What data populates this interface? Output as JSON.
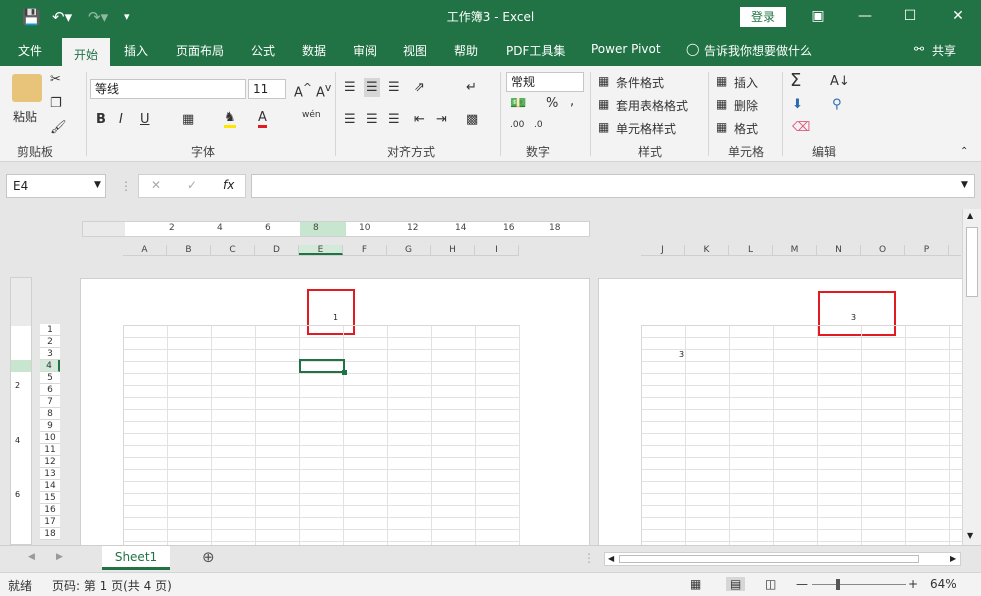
{
  "app": {
    "document_title": "工作簿3 - Excel",
    "signin_label": "登录",
    "share_label": "共享"
  },
  "tabs": [
    {
      "label": "文件"
    },
    {
      "label": "开始"
    },
    {
      "label": "插入"
    },
    {
      "label": "页面布局"
    },
    {
      "label": "公式"
    },
    {
      "label": "数据"
    },
    {
      "label": "审阅"
    },
    {
      "label": "视图"
    },
    {
      "label": "帮助"
    },
    {
      "label": "PDF工具集"
    },
    {
      "label": "Power Pivot"
    }
  ],
  "tell_me": "告诉我你想要做什么",
  "ribbon": {
    "clipboard": {
      "paste_label": "粘贴",
      "group_label": "剪贴板"
    },
    "font": {
      "font_name": "等线",
      "font_size": "11",
      "group_label": "字体",
      "bold": "B",
      "italic": "I",
      "underline": "U",
      "phonetic": "wén"
    },
    "alignment": {
      "group_label": "对齐方式"
    },
    "number": {
      "format": "常规",
      "group_label": "数字",
      "percent": "%",
      "comma": ","
    },
    "styles": {
      "conditional": "条件格式",
      "table": "套用表格格式",
      "cell_styles": "单元格样式",
      "group_label": "样式"
    },
    "cells": {
      "insert": "插入",
      "delete": "删除",
      "format": "格式",
      "group_label": "单元格"
    },
    "editing": {
      "group_label": "编辑"
    }
  },
  "formula_bar": {
    "name_box": "E4",
    "fx_label": "fx",
    "formula_value": ""
  },
  "ruler": {
    "numbers": [
      "2",
      "4",
      "6",
      "8",
      "10",
      "12",
      "14",
      "16",
      "18"
    ],
    "vertical_numbers": [
      "2",
      "4",
      "6"
    ]
  },
  "page1": {
    "columns": [
      "A",
      "B",
      "C",
      "D",
      "E",
      "F",
      "G",
      "H",
      "I"
    ],
    "rows": [
      "1",
      "2",
      "3",
      "4",
      "5",
      "6",
      "7",
      "8",
      "9",
      "10",
      "11",
      "12",
      "13",
      "14",
      "15",
      "16",
      "17",
      "18"
    ],
    "header_text": "1"
  },
  "page2": {
    "columns": [
      "J",
      "K",
      "L",
      "M",
      "N",
      "O",
      "P"
    ],
    "header_text": "3",
    "cell_value": "3"
  },
  "sheets": [
    {
      "name": "Sheet1"
    }
  ],
  "status": {
    "ready": "就绪",
    "page_info": "页码: 第 1 页(共 4 页)",
    "zoom": "64%"
  },
  "colors": {
    "excel_green": "#217346",
    "highlight_red": "#e21b22"
  }
}
